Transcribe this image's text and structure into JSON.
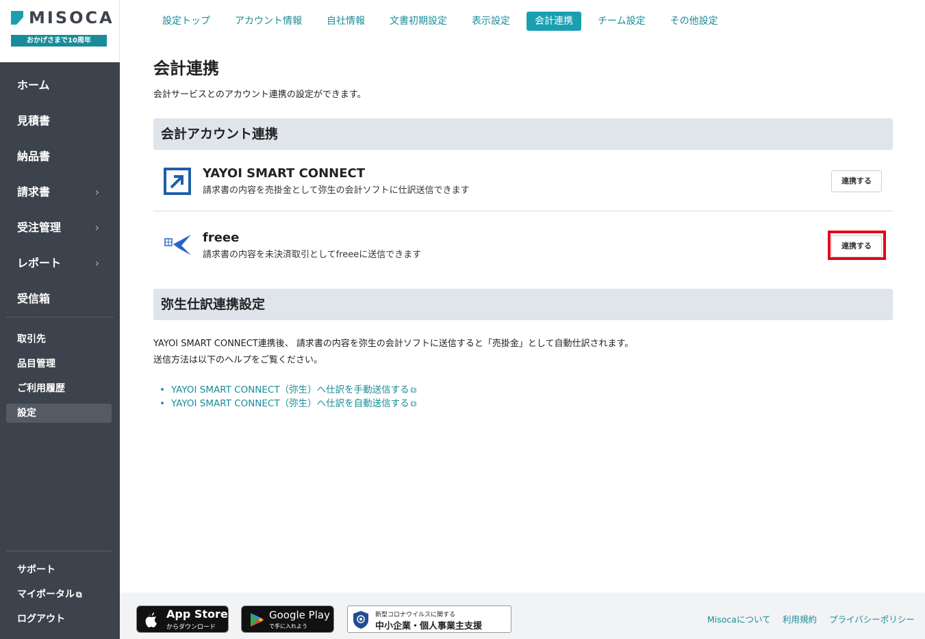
{
  "brand": {
    "logo_text": "MISOCA",
    "badge": "おかげさまで10周年",
    "accent": "#1a9fb0"
  },
  "sidebar": {
    "main_items": [
      {
        "label": "ホーム",
        "has_submenu": false
      },
      {
        "label": "見積書",
        "has_submenu": false
      },
      {
        "label": "納品書",
        "has_submenu": false
      },
      {
        "label": "請求書",
        "has_submenu": true
      },
      {
        "label": "受注管理",
        "has_submenu": true
      },
      {
        "label": "レポート",
        "has_submenu": true
      },
      {
        "label": "受信箱",
        "has_submenu": false
      }
    ],
    "sub_items": [
      {
        "label": "取引先",
        "active": false
      },
      {
        "label": "品目管理",
        "active": false
      },
      {
        "label": "ご利用履歴",
        "active": false
      },
      {
        "label": "設定",
        "active": true
      }
    ],
    "bottom_items": [
      {
        "label": "サポート"
      },
      {
        "label": "マイポータル",
        "external": true
      },
      {
        "label": "ログアウト"
      }
    ]
  },
  "tabs": [
    {
      "label": "設定トップ",
      "active": false
    },
    {
      "label": "アカウント情報",
      "active": false
    },
    {
      "label": "自社情報",
      "active": false
    },
    {
      "label": "文書初期設定",
      "active": false
    },
    {
      "label": "表示設定",
      "active": false
    },
    {
      "label": "会計連携",
      "active": true
    },
    {
      "label": "チーム設定",
      "active": false
    },
    {
      "label": "その他設定",
      "active": false
    }
  ],
  "page": {
    "title": "会計連携",
    "description": "会計サービスとのアカウント連携の設定ができます。"
  },
  "account_section": {
    "heading": "会計アカウント連携",
    "services": [
      {
        "name": "YAYOI SMART CONNECT",
        "description": "請求書の内容を売掛金として弥生の会計ソフトに仕訳送信できます",
        "button": "連携する",
        "icon": "yayoi-arrow-icon"
      },
      {
        "name": "freee",
        "description": "請求書の内容を未決済取引としてfreeeに送信できます",
        "button": "連携する",
        "icon": "freee-bird-icon"
      }
    ]
  },
  "yayoi_section": {
    "heading": "弥生仕訳連携設定",
    "text_line1": "YAYOI SMART CONNECT連携後、 請求書の内容を弥生の会計ソフトに送信すると「売掛金」として自動仕訳されます。",
    "text_line2": "送信方法は以下のヘルプをご覧ください。",
    "links": [
      {
        "label": "YAYOI SMART CONNECT（弥生）へ仕訳を手動送信する"
      },
      {
        "label": "YAYOI SMART CONNECT（弥生）へ仕訳を自動送信する"
      }
    ]
  },
  "footer": {
    "app_store": {
      "big": "App Store",
      "small": "からダウンロード"
    },
    "google_play": {
      "big": "Google Play",
      "small": "で手に入れよう"
    },
    "covid": {
      "small": "新型コロナウイルスに関する",
      "big": "中小企業・個人事業主支援"
    },
    "links": [
      "Misocaについて",
      "利用規約",
      "プライバシーポリシー"
    ]
  }
}
